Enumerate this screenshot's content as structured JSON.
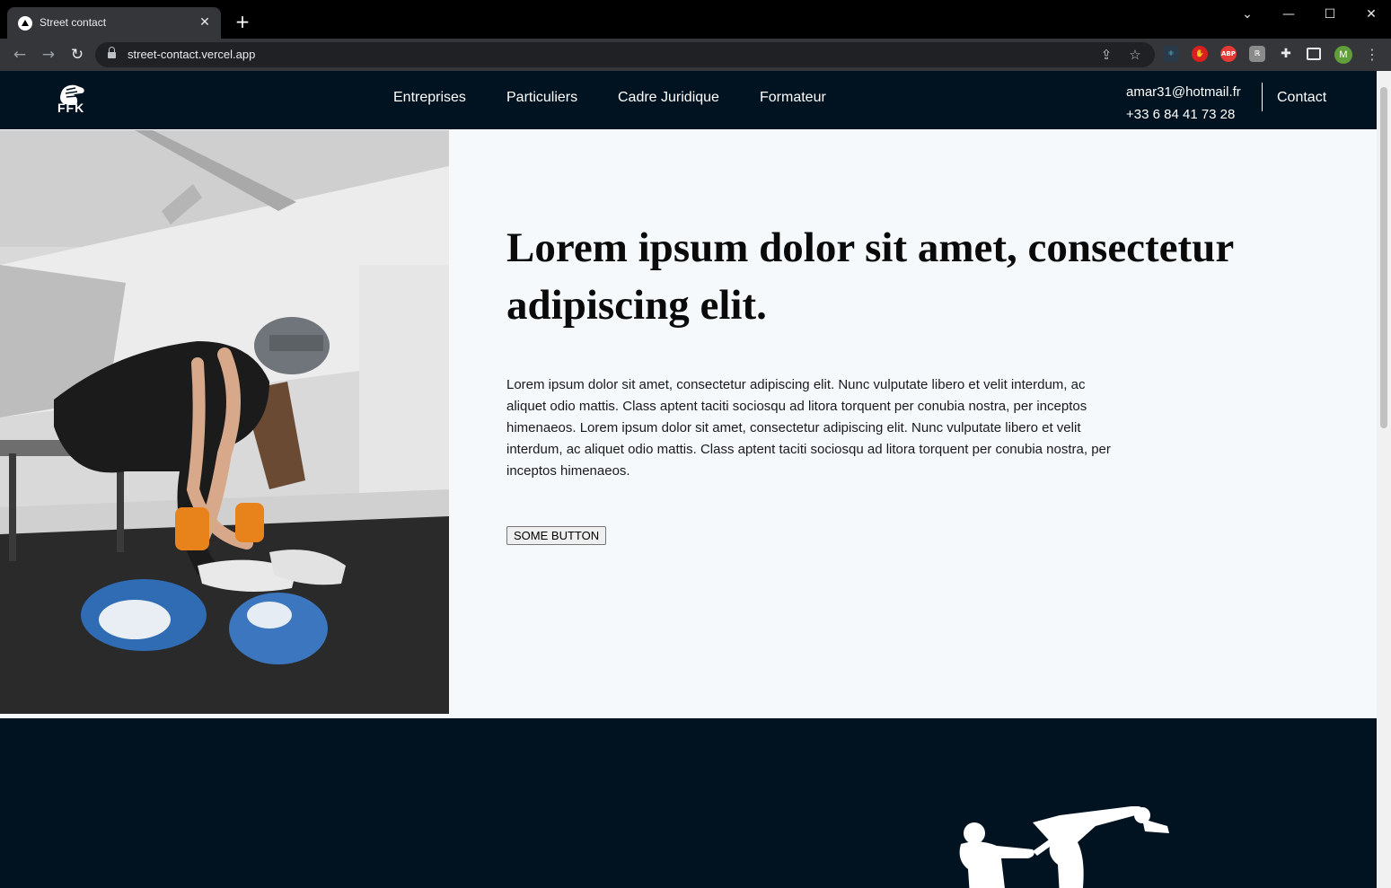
{
  "browser": {
    "tab_title": "Street contact",
    "tab_close": "✕",
    "new_tab": "+",
    "url": "street-contact.vercel.app",
    "profile_initial": "M",
    "extensions": [
      "react-devtools-icon",
      "adblock-hand-icon",
      "abp-icon",
      "generic-extension-icon",
      "puzzle-icon",
      "side-panel-icon"
    ]
  },
  "header": {
    "logo_text": "FFK",
    "nav": [
      "Entreprises",
      "Particuliers",
      "Cadre Juridique",
      "Formateur"
    ],
    "email": "amar31@hotmail.fr",
    "phone": "+33 6 84 41 73 28",
    "contact": "Contact"
  },
  "hero": {
    "title": "Lorem ipsum dolor sit amet, consectetur adipiscing elit.",
    "text": "Lorem ipsum dolor sit amet, consectetur adipiscing elit. Nunc vulputate libero et velit interdum, ac aliquet odio mattis. Class aptent taciti sociosqu ad litora torquent per conubia nostra, per inceptos himenaeos. Lorem ipsum dolor sit amet, consectetur adipiscing elit. Nunc vulputate libero et velit interdum, ac aliquet odio mattis. Class aptent taciti sociosqu ad litora torquent per conubia nostra, per inceptos himenaeos.",
    "button": "SOME BUTTON"
  },
  "colors": {
    "header_bg": "#011220",
    "hero_bg": "#f5f9fc"
  }
}
